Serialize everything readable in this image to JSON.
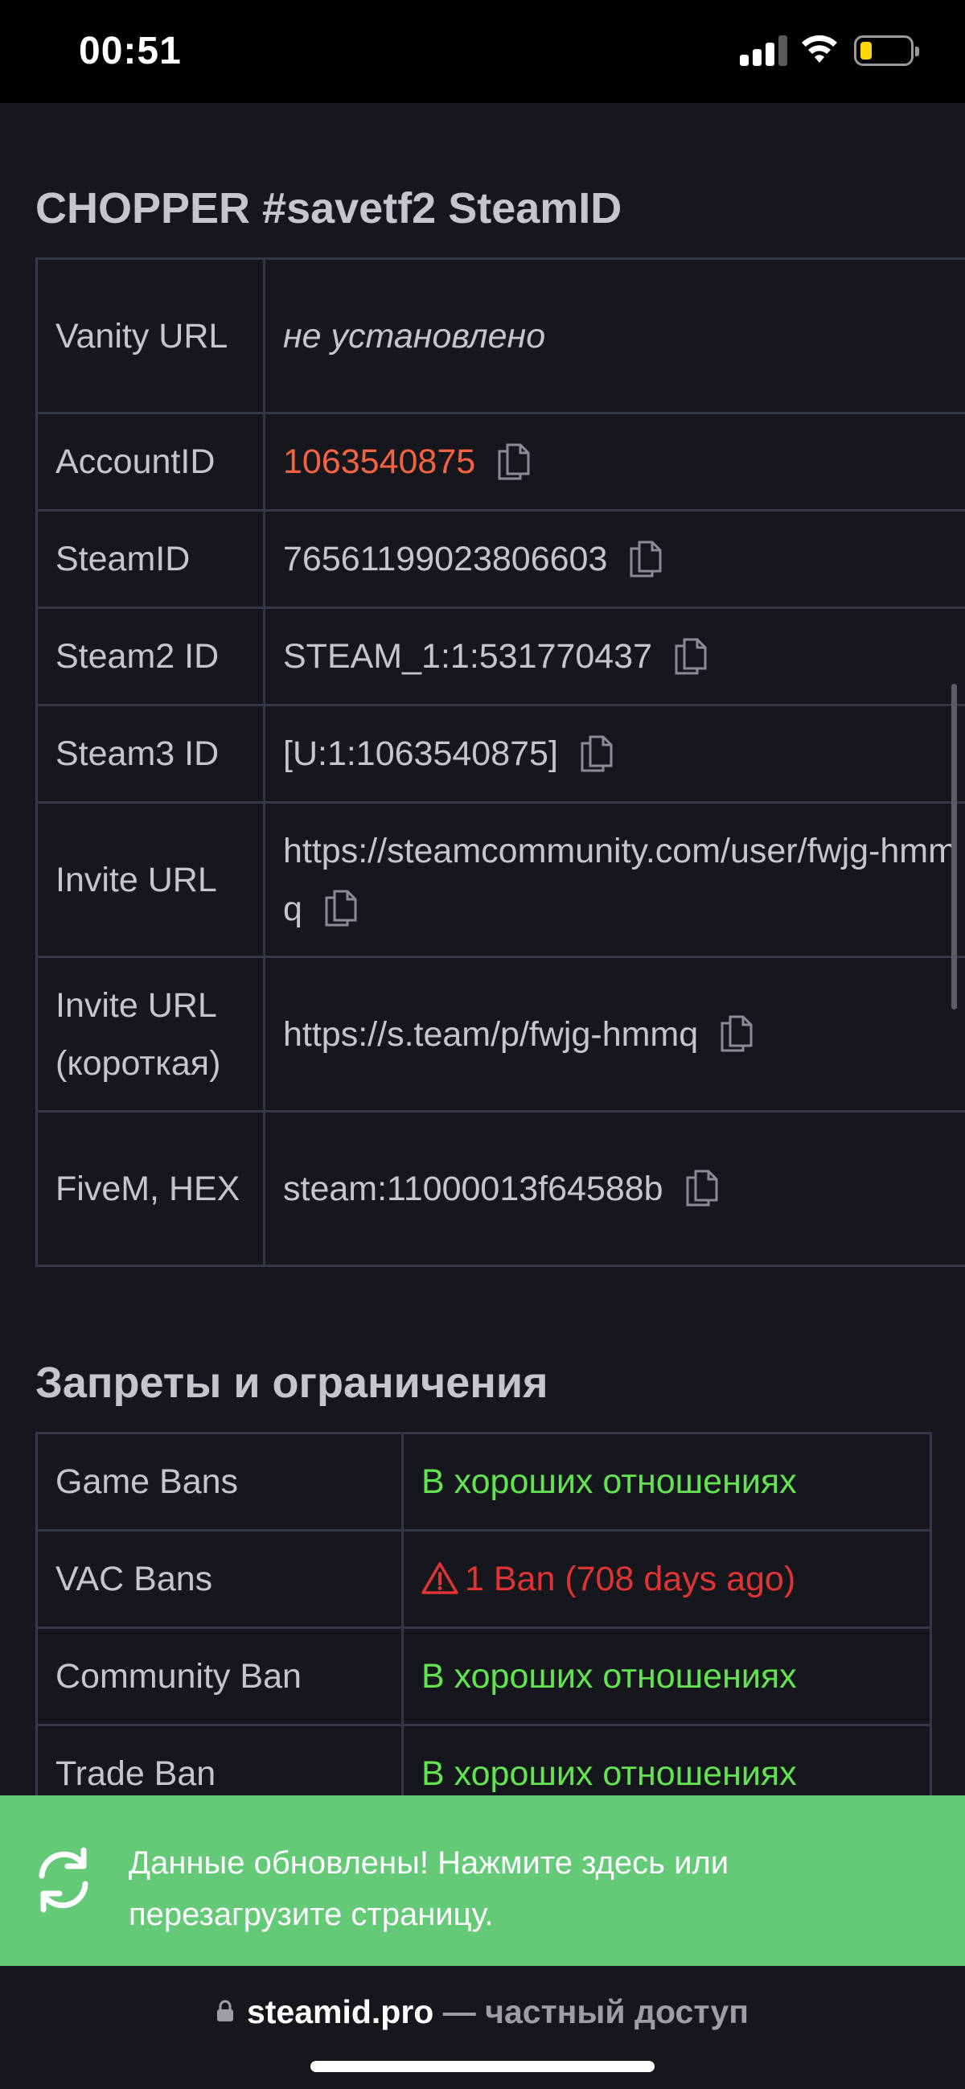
{
  "status_bar": {
    "time": "00:51"
  },
  "steamid_section": {
    "title": "CHOPPER #savetf2 SteamID",
    "rows": [
      {
        "label": "Vanity URL",
        "value": "не установлено"
      },
      {
        "label": "AccountID",
        "value": "1063540875"
      },
      {
        "label": "SteamID",
        "value": "76561199023806603"
      },
      {
        "label": "Steam2 ID",
        "value": "STEAM_1:1:531770437"
      },
      {
        "label": "Steam3 ID",
        "value": "[U:1:1063540875]"
      },
      {
        "label": "Invite URL",
        "value": "https://steamcommunity.com/user/fwjg-hmmq"
      },
      {
        "label": "Invite URL (короткая)",
        "value": "https://s.team/p/fwjg-hmmq"
      },
      {
        "label": "FiveM, HEX",
        "value": "steam:11000013f64588b"
      }
    ]
  },
  "bans_section": {
    "title": "Запреты и ограничения",
    "rows": [
      {
        "label": "Game Bans",
        "value": "В хороших отношениях",
        "status": "good"
      },
      {
        "label": "VAC Bans",
        "value": "1 Ban (708 days ago)",
        "status": "bad"
      },
      {
        "label": "Community Ban",
        "value": "В хороших отношениях",
        "status": "good"
      },
      {
        "label": "Trade Ban",
        "value": "В хороших отношениях",
        "status": "good"
      }
    ]
  },
  "toast": {
    "message": "Данные обновлены! Нажмите здесь или перезагрузите страницу.",
    "icon": "sync-icon"
  },
  "browser_bar": {
    "domain": "steamid.pro",
    "separator": "—",
    "access_label": "частный доступ"
  },
  "colors": {
    "background": "#16171d",
    "accent_orange": "#f3633f",
    "status_good": "#62e350",
    "status_bad": "#e03434",
    "toast_green": "#64ca78"
  }
}
